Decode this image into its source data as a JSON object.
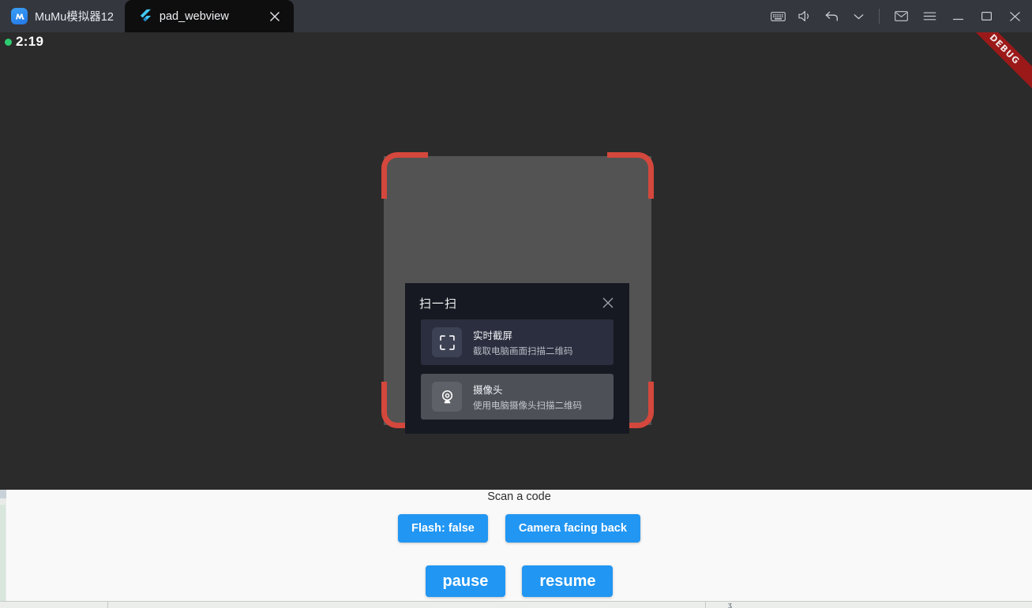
{
  "window": {
    "brand_label": "MuMu模拟器12",
    "brand_icon": "mumu-logo-icon",
    "tabs": [
      {
        "label": "pad_webview",
        "icon": "flutter-logo-icon",
        "close_icon": "close-icon",
        "active": true
      }
    ],
    "toolbar": [
      {
        "name": "keyboard-icon",
        "label": "keyboard"
      },
      {
        "name": "volume-icon",
        "label": "volume"
      },
      {
        "name": "back-icon",
        "label": "back"
      },
      {
        "name": "chevron-down-icon",
        "label": "more"
      }
    ],
    "window_controls": [
      {
        "name": "mail-icon",
        "label": "messages"
      },
      {
        "name": "menu-icon",
        "label": "menu"
      },
      {
        "name": "minimize-icon",
        "label": "minimize"
      },
      {
        "name": "maximize-icon",
        "label": "maximize"
      },
      {
        "name": "close-icon",
        "label": "close"
      }
    ]
  },
  "screen": {
    "status_time": "2:19",
    "recording_indicator": "record-dot-icon",
    "debug_banner": "DEBUG",
    "viewfinder": {
      "corner_color": "#d4473c",
      "preview_color": "#535353"
    }
  },
  "scan_dialog": {
    "title": "扫一扫",
    "close_icon": "close-icon",
    "options": [
      {
        "icon": "scan-frame-icon",
        "title": "实时截屏",
        "subtitle": "截取电脑画面扫描二维码"
      },
      {
        "icon": "webcam-icon",
        "title": "摄像头",
        "subtitle": "使用电脑摄像头扫描二维码"
      }
    ]
  },
  "flutter_panel": {
    "caption": "Scan a code",
    "accent_color": "#2196f3",
    "toggle_buttons": [
      {
        "label": "Flash: false"
      },
      {
        "label": "Camera facing back"
      }
    ],
    "transport_buttons": [
      {
        "label": "pause"
      },
      {
        "label": "resume"
      }
    ]
  },
  "underlying_window": {
    "glyph": "ʓ"
  }
}
